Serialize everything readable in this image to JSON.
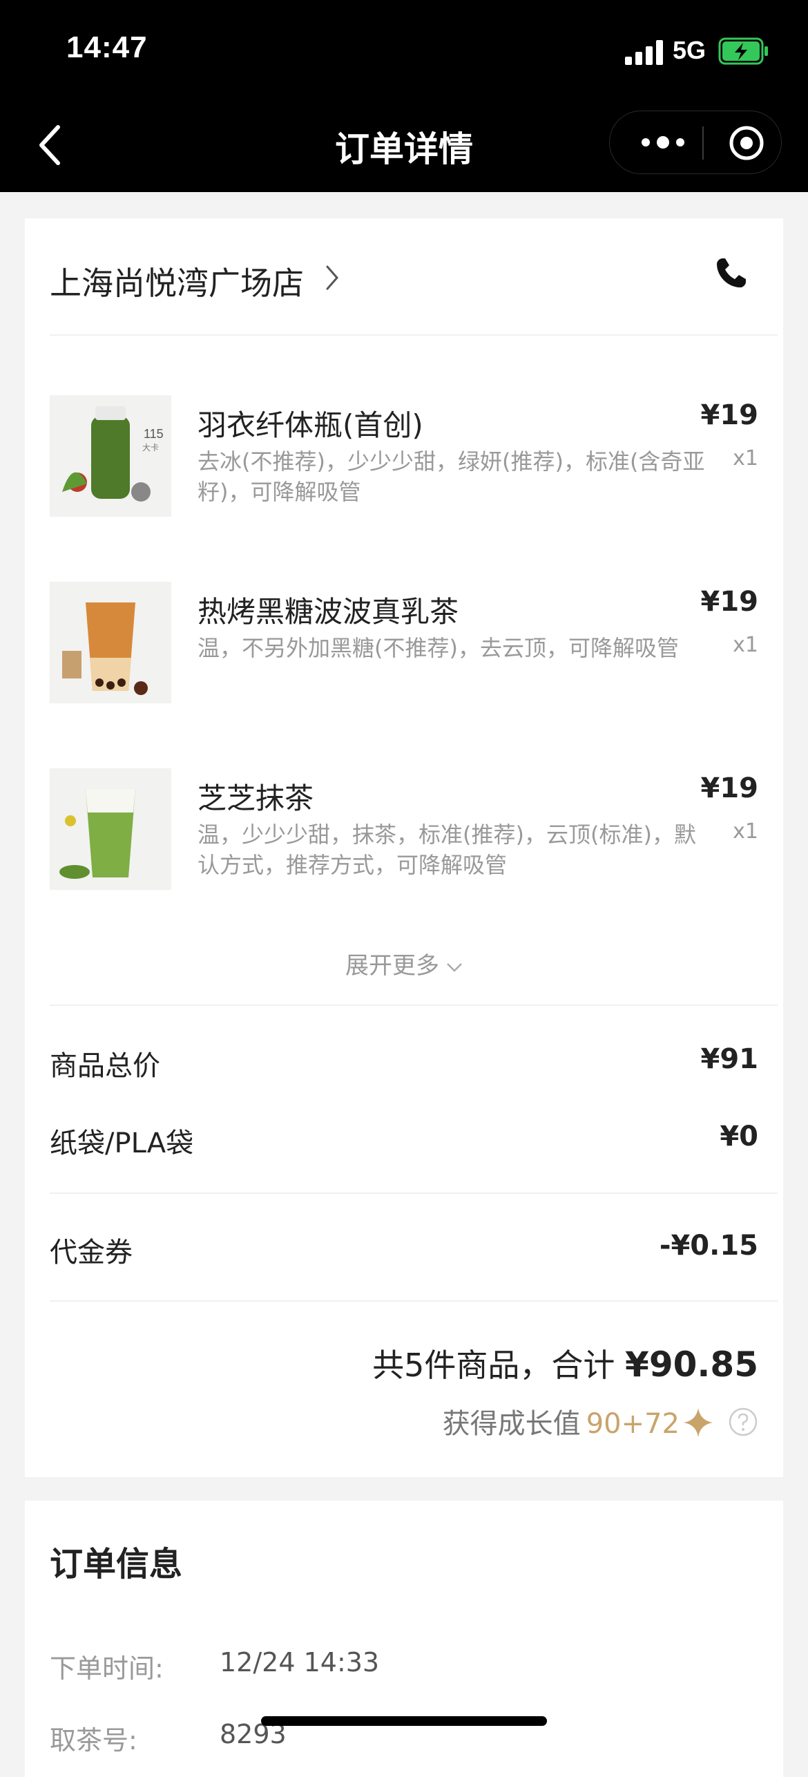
{
  "status_bar": {
    "time": "14:47",
    "network": "5G"
  },
  "nav": {
    "title": "订单详情"
  },
  "store": {
    "name": "上海尚悦湾广场店"
  },
  "items": [
    {
      "name": "羽衣纤体瓶(首创)",
      "desc": "去冰(不推荐)，少少少甜，绿妍(推荐)，标准(含奇亚籽)，可降解吸管",
      "price": "¥19",
      "qty": "x1",
      "thumb_label": "115",
      "thumb_sub": "大卡"
    },
    {
      "name": "热烤黑糖波波真乳茶",
      "desc": "温，不另外加黑糖(不推荐)，去云顶，可降解吸管",
      "price": "¥19",
      "qty": "x1"
    },
    {
      "name": "芝芝抹茶",
      "desc": "温，少少少甜，抹茶，标准(推荐)，云顶(标准)，默认方式，推荐方式，可降解吸管",
      "price": "¥19",
      "qty": "x1"
    }
  ],
  "expand_label": "展开更多",
  "fees": [
    {
      "label": "商品总价",
      "value": "¥91"
    },
    {
      "label": "纸袋/PLA袋",
      "value": "¥0"
    },
    {
      "label": "代金券",
      "value": "-¥0.15"
    }
  ],
  "summary": {
    "prefix": "共5件商品，合计",
    "total": "¥90.85"
  },
  "growth": {
    "label": "获得成长值",
    "value": "90+72"
  },
  "order_info": {
    "title": "订单信息",
    "rows": [
      {
        "label": "下单时间:",
        "value": "12/24 14:33"
      },
      {
        "label": "取茶号:",
        "value": "8293"
      }
    ]
  },
  "colors": {
    "header_bg": "#000000",
    "gold": "#c9a46a",
    "muted": "#999999"
  }
}
